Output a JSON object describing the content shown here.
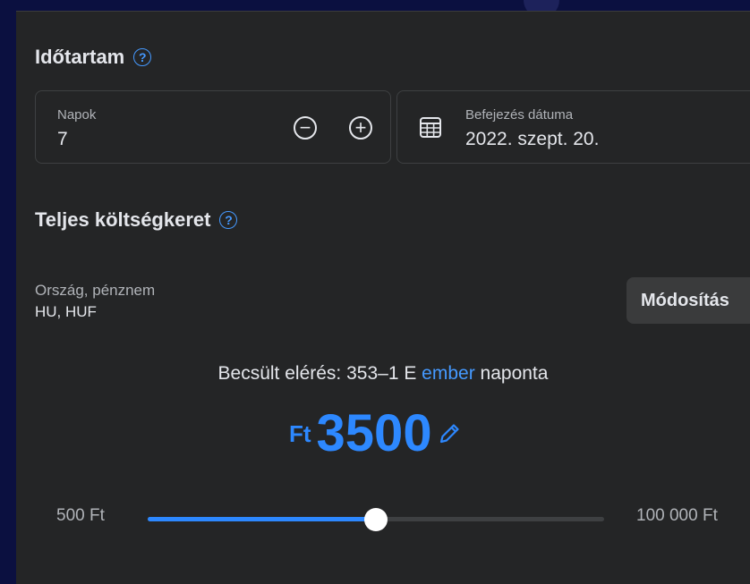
{
  "duration": {
    "title": "Időtartam",
    "days_label": "Napok",
    "days_value": "7",
    "end_date_label": "Befejezés dátuma",
    "end_date_value": "2022. szept. 20."
  },
  "budget": {
    "title": "Teljes költségkeret",
    "country_label": "Ország, pénznem",
    "country_value": "HU, HUF",
    "modify_label": "Módosítás",
    "reach_prefix": "Becsült elérés: 353–1 E ",
    "reach_link": "ember",
    "reach_suffix": " naponta",
    "currency_symbol": "Ft",
    "amount": "3500",
    "slider_min_label": "500 Ft",
    "slider_max_label": "100 000 Ft",
    "slider_fraction": 0.5
  },
  "icons": {
    "help": "?",
    "minus": "−",
    "plus": "+"
  },
  "colors": {
    "accent": "#2d88ff",
    "panel": "#242526",
    "background": "#0b1040"
  }
}
